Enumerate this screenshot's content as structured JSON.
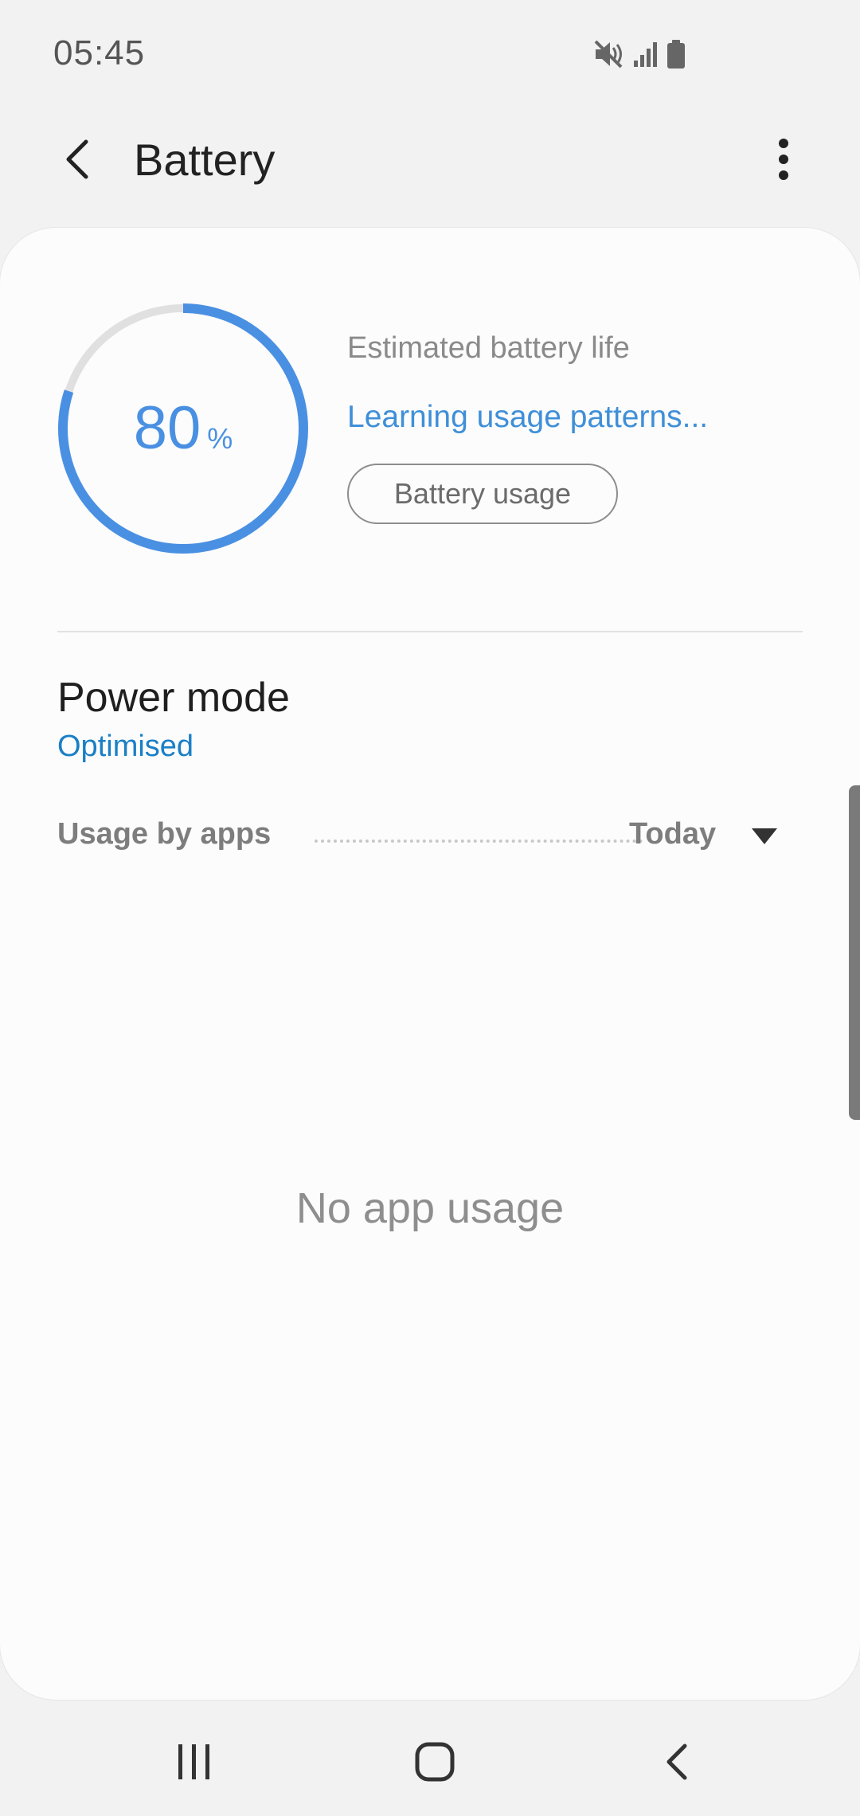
{
  "status_bar": {
    "time": "05:45",
    "icons": [
      "mute-icon",
      "signal-icon",
      "battery-icon"
    ]
  },
  "app_bar": {
    "title": "Battery",
    "back_icon": "back-arrow-icon",
    "more_icon": "more-vertical-icon"
  },
  "battery": {
    "level": 80,
    "unit": "%",
    "estimate_label": "Estimated battery life",
    "estimate_value": "Learning usage patterns...",
    "usage_button_label": "Battery usage",
    "ring_color": "#4a90e2",
    "ring_track_color": "#e0e0e0"
  },
  "power_mode": {
    "title": "Power mode",
    "value": "Optimised"
  },
  "usage": {
    "label": "Usage by apps",
    "period": "Today",
    "empty_text": "No app usage"
  },
  "nav_bar": {
    "recents_icon": "recents-icon",
    "home_icon": "home-icon",
    "back_icon": "back-icon"
  }
}
